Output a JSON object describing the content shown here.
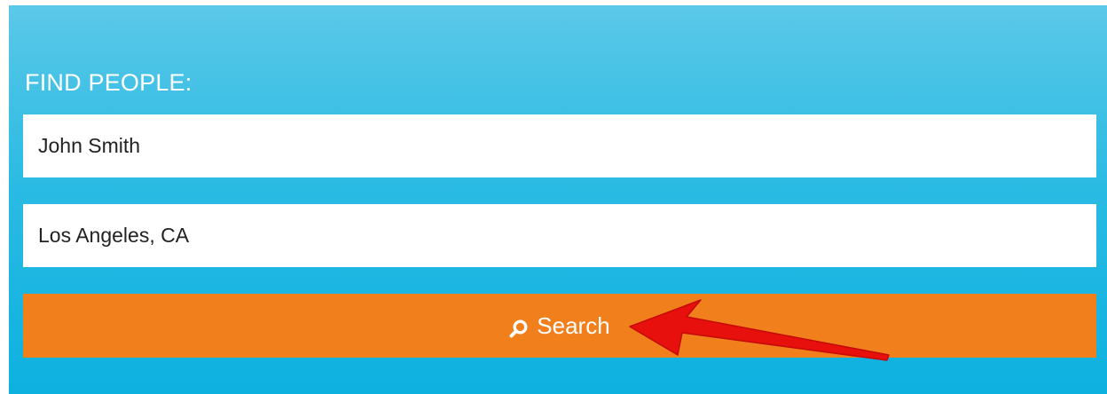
{
  "form": {
    "heading": "FIND PEOPLE:",
    "name_value": "John Smith",
    "location_value": "Los Angeles, CA",
    "search_label": "Search",
    "search_icon": "search-icon"
  },
  "annotation": {
    "arrow_icon": "red-arrow-icon",
    "arrow_color": "#e8100d"
  },
  "colors": {
    "panel_top": "#5bc8e8",
    "panel_bottom": "#0db1e0",
    "button": "#f07f1c",
    "text_light": "#ffffff"
  }
}
